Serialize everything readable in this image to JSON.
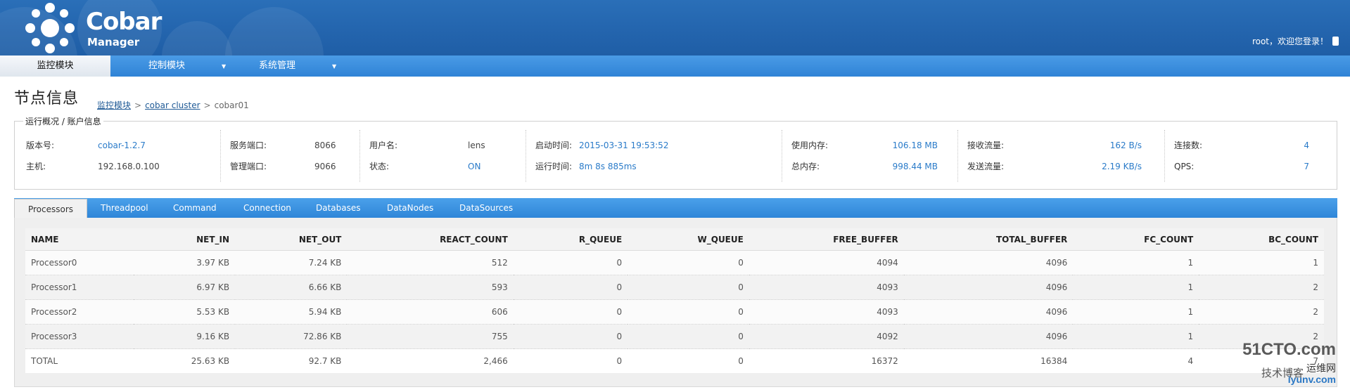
{
  "header": {
    "logo_title": "Cobar",
    "logo_subtitle": "Manager",
    "user_text": "root，欢迎您登录！"
  },
  "nav": [
    {
      "label": "监控模块",
      "active": true
    },
    {
      "label": "控制模块",
      "dropdown": true
    },
    {
      "label": "系统管理",
      "dropdown": true
    }
  ],
  "page": {
    "title": "节点信息",
    "breadcrumb": [
      "监控模块",
      "cobar cluster",
      "cobar01"
    ]
  },
  "info": {
    "legend": "运行概况 / 账户信息",
    "version_label": "版本号:",
    "version": "cobar-1.2.7",
    "host_label": "主机:",
    "host": "192.168.0.100",
    "service_port_label": "服务端口:",
    "service_port": "8066",
    "manage_port_label": "管理端口:",
    "manage_port": "9066",
    "username_label": "用户名:",
    "username": "lens",
    "status_label": "状态:",
    "status": "ON",
    "start_time_label": "启动时间:",
    "start_time": "2015-03-31 19:53:52",
    "run_time_label": "运行时间:",
    "run_time": "8m 8s 885ms",
    "used_mem_label": "使用内存:",
    "used_mem": "106.18 MB",
    "total_mem_label": "总内存:",
    "total_mem": "998.44 MB",
    "recv_label": "接收流量:",
    "recv": "162 B/s",
    "send_label": "发送流量:",
    "send": "2.19 KB/s",
    "conn_label": "连接数:",
    "conn": "4",
    "qps_label": "QPS:",
    "qps": "7"
  },
  "tabs": [
    "Processors",
    "Threadpool",
    "Command",
    "Connection",
    "Databases",
    "DataNodes",
    "DataSources"
  ],
  "table": {
    "columns": [
      "NAME",
      "NET_IN",
      "NET_OUT",
      "REACT_COUNT",
      "R_QUEUE",
      "W_QUEUE",
      "FREE_BUFFER",
      "TOTAL_BUFFER",
      "FC_COUNT",
      "BC_COUNT"
    ],
    "rows": [
      [
        "Processor0",
        "3.97 KB",
        "7.24 KB",
        "512",
        "0",
        "0",
        "4094",
        "4096",
        "1",
        "1"
      ],
      [
        "Processor1",
        "6.97 KB",
        "6.66 KB",
        "593",
        "0",
        "0",
        "4093",
        "4096",
        "1",
        "2"
      ],
      [
        "Processor2",
        "5.53 KB",
        "5.94 KB",
        "606",
        "0",
        "0",
        "4093",
        "4096",
        "1",
        "2"
      ],
      [
        "Processor3",
        "9.16 KB",
        "72.86 KB",
        "755",
        "0",
        "0",
        "4092",
        "4096",
        "1",
        "2"
      ],
      [
        "TOTAL",
        "25.63 KB",
        "92.7 KB",
        "2,466",
        "0",
        "0",
        "16372",
        "16384",
        "4",
        "7"
      ]
    ]
  },
  "watermark": {
    "line1": "51CTO.com",
    "line2": "技术博客",
    "line3": "运维网",
    "line4": "iyunv.com"
  },
  "colors": {
    "header": "#2364ad",
    "nav": "#2f83d6",
    "link": "#2a7bc9"
  }
}
